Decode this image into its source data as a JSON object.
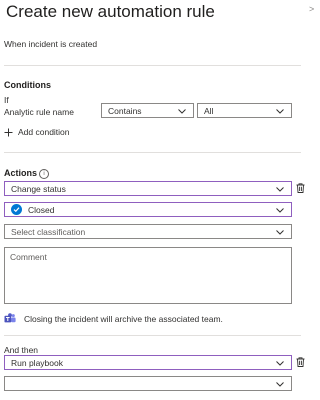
{
  "panel": {
    "title": "Create new automation rule",
    "trigger_text": "When incident is created"
  },
  "conditions": {
    "heading": "Conditions",
    "if_label": "If",
    "field_label": "Analytic rule name",
    "operator": "Contains",
    "value": "All",
    "add_condition": "Add condition"
  },
  "actions": {
    "heading": "Actions",
    "action_type": "Change status",
    "status": "Closed",
    "classification_placeholder": "Select classification",
    "comment_placeholder": "Comment",
    "teams_note": "Closing the incident will archive the associated team."
  },
  "and_then": {
    "label": "And then",
    "action_type": "Run playbook",
    "playbook": ""
  },
  "colors": {
    "accent": "#8f5fbf",
    "status_blue": "#0078d4",
    "teams_purple": "#5059c9"
  },
  "icons": [
    "close-icon",
    "plus-icon",
    "info-icon",
    "chevron-down-icon",
    "trash-icon",
    "checkmark-icon",
    "teams-icon"
  ]
}
